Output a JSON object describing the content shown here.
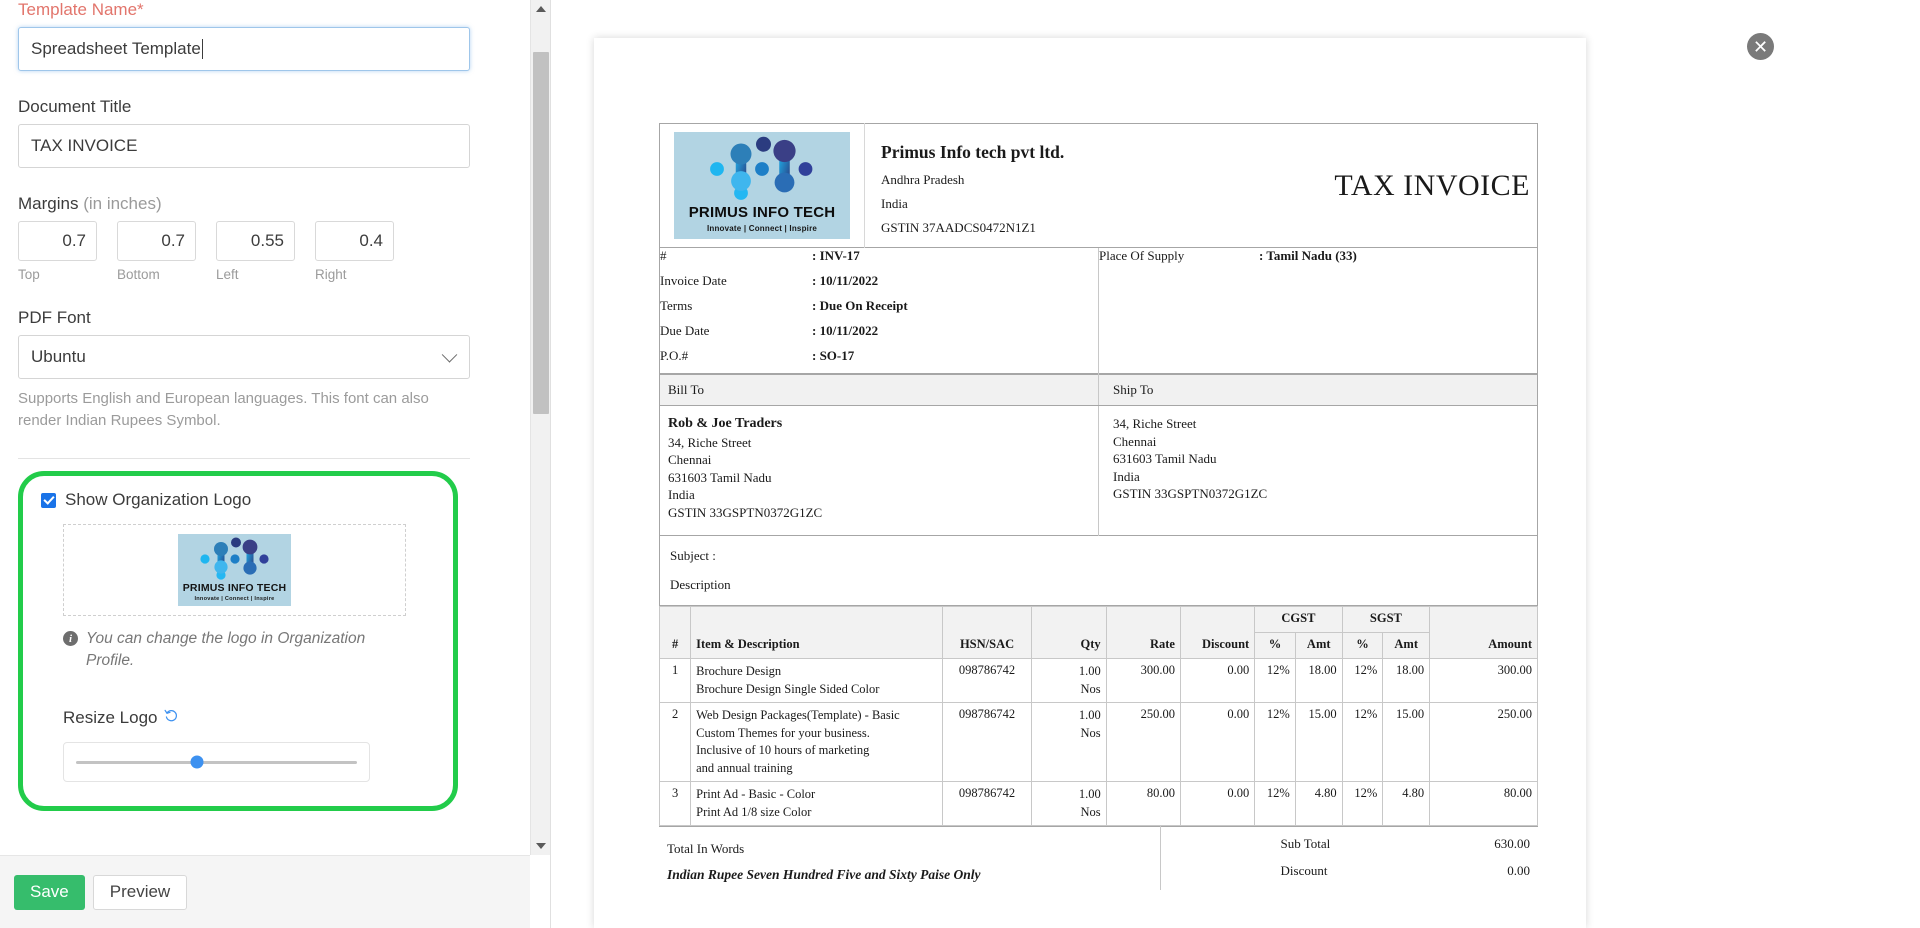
{
  "settings": {
    "template_name": {
      "label": "Template Name*",
      "value": "Spreadsheet Template"
    },
    "document_title": {
      "label": "Document Title",
      "value": "TAX INVOICE"
    },
    "margins": {
      "label": "Margins",
      "label_suffix": "(in inches)",
      "fields": [
        {
          "caption": "Top",
          "value": "0.7"
        },
        {
          "caption": "Bottom",
          "value": "0.7"
        },
        {
          "caption": "Left",
          "value": "0.55"
        },
        {
          "caption": "Right",
          "value": "0.4"
        }
      ]
    },
    "pdf_font": {
      "label": "PDF Font",
      "value": "Ubuntu",
      "help": "Supports English and European languages. This font can also render Indian Rupees Symbol."
    },
    "logo": {
      "checkbox_label": "Show Organization Logo",
      "checked": true,
      "logo_name": "PRIMUS INFO TECH",
      "logo_tagline": "Innovate | Connect | Inspire",
      "note": "You can change the logo in Organization Profile.",
      "resize_label": "Resize Logo",
      "reset_icon": "reset-icon",
      "slider_position_pct": 43,
      "highlight_color": "#22cc4a"
    },
    "actions": {
      "save_label": "Save",
      "preview_label": "Preview",
      "save_color": "#36bd6c"
    }
  },
  "preview": {
    "close_label": "✕",
    "invoice": {
      "logo_name": "PRIMUS INFO TECH",
      "logo_tagline": "Innovate | Connect | Inspire",
      "org_name": "Primus Info tech pvt ltd.",
      "org_lines": [
        "Andhra Pradesh",
        "India",
        "GSTIN 37AADCS0472N1Z1"
      ],
      "title": "TAX INVOICE",
      "meta_left": [
        {
          "key": "#",
          "value": ": INV-17"
        },
        {
          "key": "Invoice Date",
          "value": ": 10/11/2022"
        },
        {
          "key": "Terms",
          "value": ": Due On Receipt"
        },
        {
          "key": "Due Date",
          "value": ": 10/11/2022"
        },
        {
          "key": "P.O.#",
          "value": ": SO-17"
        }
      ],
      "meta_right": [
        {
          "key": "Place Of Supply",
          "value": ": Tamil Nadu (33)"
        }
      ],
      "bill_to_heading": "Bill To",
      "ship_to_heading": "Ship To",
      "bill_to": {
        "name": "Rob & Joe Traders",
        "lines": [
          "34, Riche Street",
          "Chennai",
          "631603 Tamil Nadu",
          "India",
          "GSTIN 33GSPTN0372G1ZC"
        ]
      },
      "ship_to": {
        "name": "",
        "lines": [
          "34, Riche Street",
          "Chennai",
          "631603 Tamil Nadu",
          "India",
          "GSTIN 33GSPTN0372G1ZC"
        ]
      },
      "subject_label": "Subject :",
      "description_label": "Description",
      "table": {
        "group_headers": {
          "cgst": "CGST",
          "sgst": "SGST"
        },
        "columns": [
          "#",
          "Item & Description",
          "HSN/SAC",
          "Qty",
          "Rate",
          "Discount",
          "%",
          "Amt",
          "%",
          "Amt",
          "Amount"
        ],
        "rows": [
          {
            "idx": "1",
            "item": "Brochure Design",
            "item_desc": [
              "Brochure Design Single Sided Color"
            ],
            "hsn": "098786742",
            "qty": "1.00",
            "unit": "Nos",
            "rate": "300.00",
            "discount": "0.00",
            "cgst_pct": "12%",
            "cgst_amt": "18.00",
            "sgst_pct": "12%",
            "sgst_amt": "18.00",
            "amount": "300.00"
          },
          {
            "idx": "2",
            "item": "Web Design Packages(Template) - Basic",
            "item_desc": [
              "Custom Themes for your business.",
              "Inclusive of 10 hours of marketing",
              "and annual training"
            ],
            "hsn": "098786742",
            "qty": "1.00",
            "unit": "Nos",
            "rate": "250.00",
            "discount": "0.00",
            "cgst_pct": "12%",
            "cgst_amt": "15.00",
            "sgst_pct": "12%",
            "sgst_amt": "15.00",
            "amount": "250.00"
          },
          {
            "idx": "3",
            "item": "Print Ad - Basic - Color",
            "item_desc": [
              "Print Ad 1/8 size Color"
            ],
            "hsn": "098786742",
            "qty": "1.00",
            "unit": "Nos",
            "rate": "80.00",
            "discount": "0.00",
            "cgst_pct": "12%",
            "cgst_amt": "4.80",
            "sgst_pct": "12%",
            "sgst_amt": "4.80",
            "amount": "80.00"
          }
        ]
      },
      "total_in_words_label": "Total In Words",
      "total_in_words_value": "Indian Rupee Seven Hundred Five and Sixty Paise Only",
      "totals": [
        {
          "label": "Sub Total",
          "value": "630.00"
        },
        {
          "label": "Discount",
          "value": "0.00"
        }
      ]
    }
  }
}
